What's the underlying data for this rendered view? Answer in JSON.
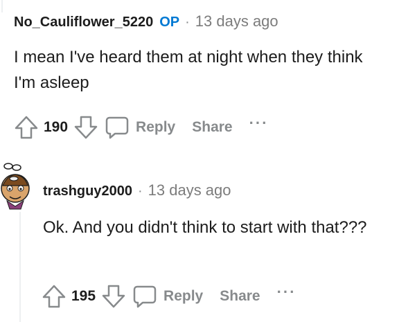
{
  "comments": [
    {
      "author": "No_Cauliflower_5220",
      "op_badge": "OP",
      "separator": "·",
      "time": "13 days ago",
      "body": "I mean I've heard them at night when they think I'm asleep",
      "score": "190",
      "reply_label": "Reply",
      "share_label": "Share",
      "more_label": "···"
    },
    {
      "author": "trashguy2000",
      "separator": "·",
      "time": "13 days ago",
      "body": "Ok. And you didn't think to start with that???",
      "score": "195",
      "reply_label": "Reply",
      "share_label": "Share",
      "more_label": "···"
    }
  ],
  "colors": {
    "op_badge": "#0079d3",
    "muted_text": "#878a8c",
    "thread_line": "#edeff1"
  },
  "icons": [
    "upvote-icon",
    "downvote-icon",
    "reply-icon",
    "avatar"
  ]
}
